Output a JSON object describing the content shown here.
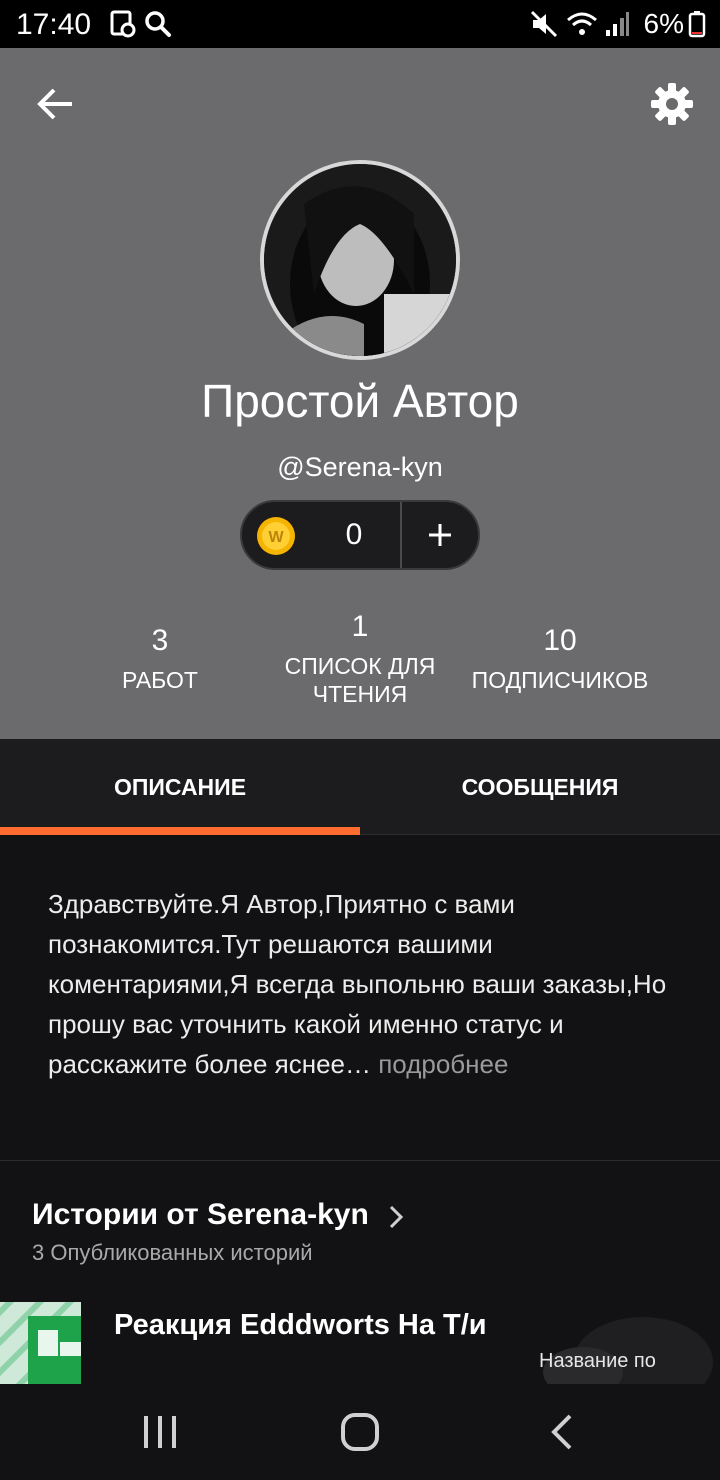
{
  "status_bar": {
    "time": "17:40",
    "battery": "6%",
    "icons": [
      "screenshot-icon",
      "search-icon",
      "mute-icon",
      "wifi-icon",
      "signal-icon",
      "battery-icon"
    ]
  },
  "profile": {
    "display_name": "Простой Автор",
    "username": "@Serena-kyn",
    "coins": "0",
    "stats": [
      {
        "number": "3",
        "label": "РАБОТ"
      },
      {
        "number": "1",
        "label": "СПИСОК ДЛЯ ЧТЕНИЯ"
      },
      {
        "number": "10",
        "label": "ПОДПИСЧИКОВ"
      }
    ]
  },
  "tabs": [
    {
      "label": "ОПИСАНИЕ",
      "active": true
    },
    {
      "label": "СООБЩЕНИЯ",
      "active": false
    }
  ],
  "description": {
    "text": "Здравствуйте.Я Автор,Приятно с вами познакомится.Тут решаются вашими коментариями,Я всегда выпольню ваши заказы,Но прошу вас уточнить какой именно статус и расскажите более яснее…",
    "more": " подробнее"
  },
  "stories": {
    "title": "Истории от Serena-kyn",
    "subtitle": "3 Опубликованных историй",
    "items": [
      {
        "title": "Реакция Edddworts На Т/и"
      },
      {
        "caption": "Название по"
      }
    ]
  },
  "colors": {
    "header_bg": "#6b6a6d",
    "page_bg": "#121113",
    "accent": "#ff6c2f",
    "coin": "#f5b400"
  }
}
